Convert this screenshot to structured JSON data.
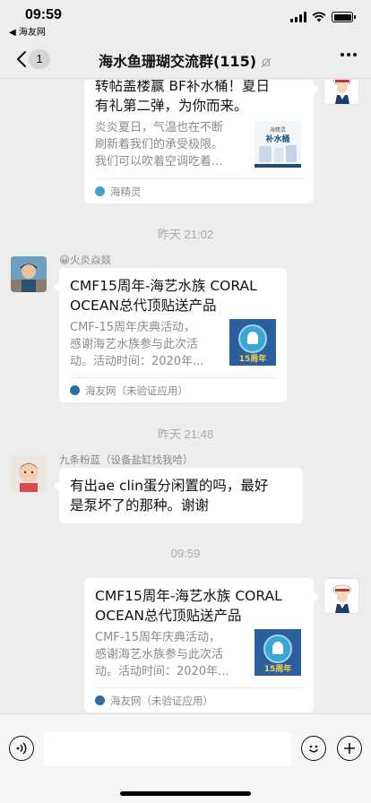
{
  "status_bar": {
    "time": "09:59",
    "back_app": "◀ 海友网"
  },
  "nav": {
    "unread": "1",
    "title": "海水鱼珊瑚交流群(115)"
  },
  "messages": [
    {
      "card": {
        "title": "转帖盖楼赢 BF补水桶！夏日有礼第二弹，为你而来。",
        "title_lines": [
          "转帖盖楼赢 BF补水桶！夏日",
          "有礼第二弹，为你而来。"
        ],
        "desc_lines": [
          "炎炎夏日，气温也在不断",
          "刷新着我们的承受极限。",
          "我们可以吹着空调吃着..."
        ],
        "thumb_text_top": "海精灵",
        "thumb_text": "补水桶",
        "source": "海精灵"
      }
    },
    {
      "time": "昨天 21:02"
    },
    {
      "sender": "😀火炎焱燚",
      "card": {
        "title_lines": [
          "CMF15周年-海艺水族 CORAL",
          "OCEAN总代顶贴送产品"
        ],
        "desc_lines": [
          "CMF-15周年庆典活动，",
          "感谢海艺水族参与此次活",
          "动。活动时间：2020年..."
        ],
        "thumb_text": "15周年",
        "source": "海友网（未验证应用）"
      }
    },
    {
      "time": "昨天 21:48"
    },
    {
      "sender": "九条粉蓝（设备盐缸找我哈）",
      "text_lines": [
        "有出ae  clin蛋分闲置的吗，最好",
        "是泵坏了的那种。谢谢"
      ]
    },
    {
      "time": "09:59"
    },
    {
      "card": {
        "title_lines": [
          "CMF15周年-海艺水族 CORAL",
          "OCEAN总代顶贴送产品"
        ],
        "desc_lines": [
          "CMF-15周年庆典活动，",
          "感谢海艺水族参与此次活",
          "动。活动时间：2020年..."
        ],
        "thumb_text": "15周年",
        "source": "海友网（未验证应用）"
      }
    }
  ],
  "input": {
    "placeholder": ""
  },
  "colors": {
    "background": "#ededed",
    "bubble": "#ffffff",
    "muted_text": "#8a8a8a"
  }
}
